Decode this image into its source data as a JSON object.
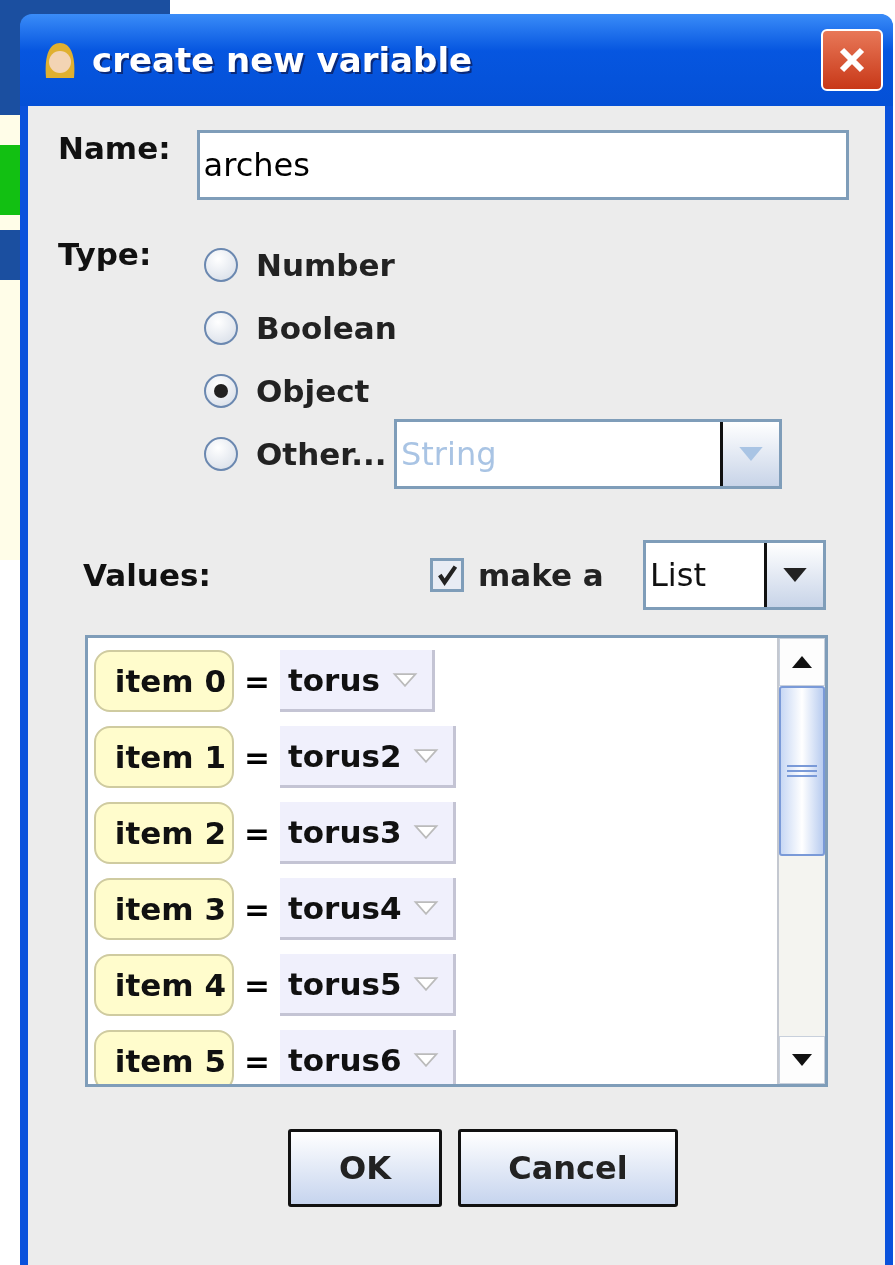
{
  "window": {
    "title": "create new variable"
  },
  "name": {
    "label": "Name:",
    "value": "arches"
  },
  "type": {
    "label": "Type:",
    "options": [
      {
        "label": "Number",
        "selected": false
      },
      {
        "label": "Boolean",
        "selected": false
      },
      {
        "label": "Object",
        "selected": true
      },
      {
        "label": "Other...",
        "selected": false
      }
    ],
    "other_combo": {
      "value": "String",
      "disabled": true
    }
  },
  "values": {
    "label": "Values:",
    "make_collection": {
      "label": "make a",
      "checked": true
    },
    "collection_combo": {
      "value": "List"
    },
    "items": [
      {
        "name": "item 0",
        "operator": "=",
        "value": "torus"
      },
      {
        "name": "item 1",
        "operator": "=",
        "value": "torus2"
      },
      {
        "name": "item 2",
        "operator": "=",
        "value": "torus3"
      },
      {
        "name": "item 3",
        "operator": "=",
        "value": "torus4"
      },
      {
        "name": "item 4",
        "operator": "=",
        "value": "torus5"
      },
      {
        "name": "item 5",
        "operator": "=",
        "value": "torus6"
      }
    ]
  },
  "buttons": [
    "OK",
    "Cancel"
  ]
}
